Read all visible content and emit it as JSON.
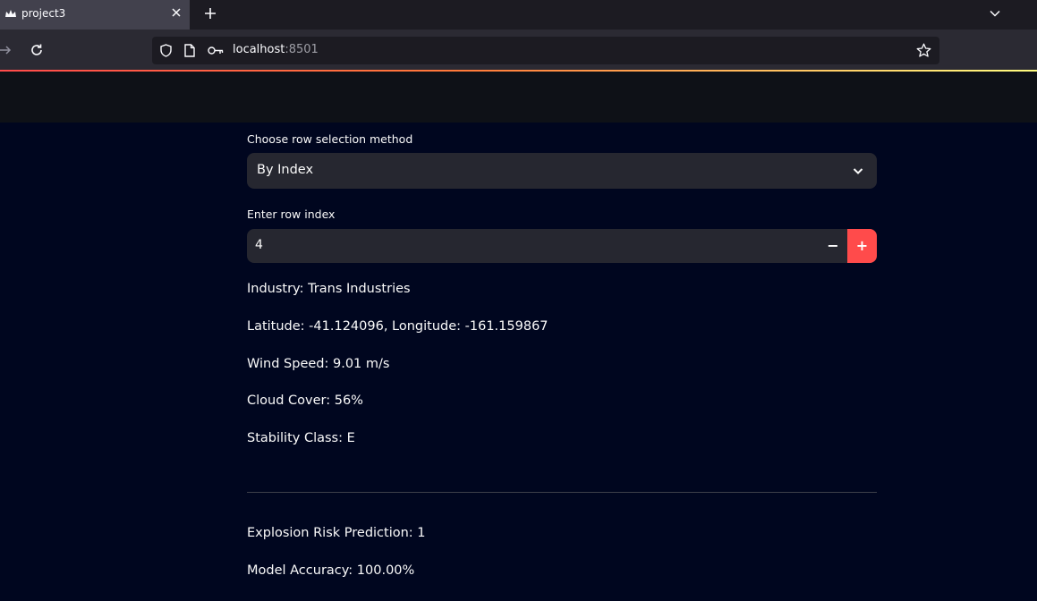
{
  "browser": {
    "tab_title": "project3",
    "url_host": "localhost",
    "url_port": ":8501"
  },
  "icons": {
    "favicon": "streamlit-crown-icon",
    "tab_close": "close-icon",
    "new_tab": "plus-icon",
    "tab_list": "chevron-down-icon",
    "forward": "arrow-right-icon",
    "reload": "reload-icon",
    "shield": "shield-icon",
    "page": "page-icon",
    "key": "key-icon",
    "bookmark": "star-icon",
    "select_chevron": "chevron-down-icon"
  },
  "colors": {
    "accent": "#ff4b4b",
    "background": "#00061f",
    "widget": "#262730"
  },
  "form": {
    "select_label": "Choose row selection method",
    "select_value": "By Index",
    "number_label": "Enter row index",
    "number_value": "4",
    "minus": "−",
    "plus": "+"
  },
  "info": {
    "industry": "Industry: Trans Industries",
    "location": "Latitude: -41.124096, Longitude: -161.159867",
    "wind": "Wind Speed: 9.01 m/s",
    "cloud": "Cloud Cover: 56%",
    "stability": "Stability Class: E"
  },
  "results": {
    "prediction": "Explosion Risk Prediction: 1",
    "accuracy": "Model Accuracy: 100.00%"
  }
}
